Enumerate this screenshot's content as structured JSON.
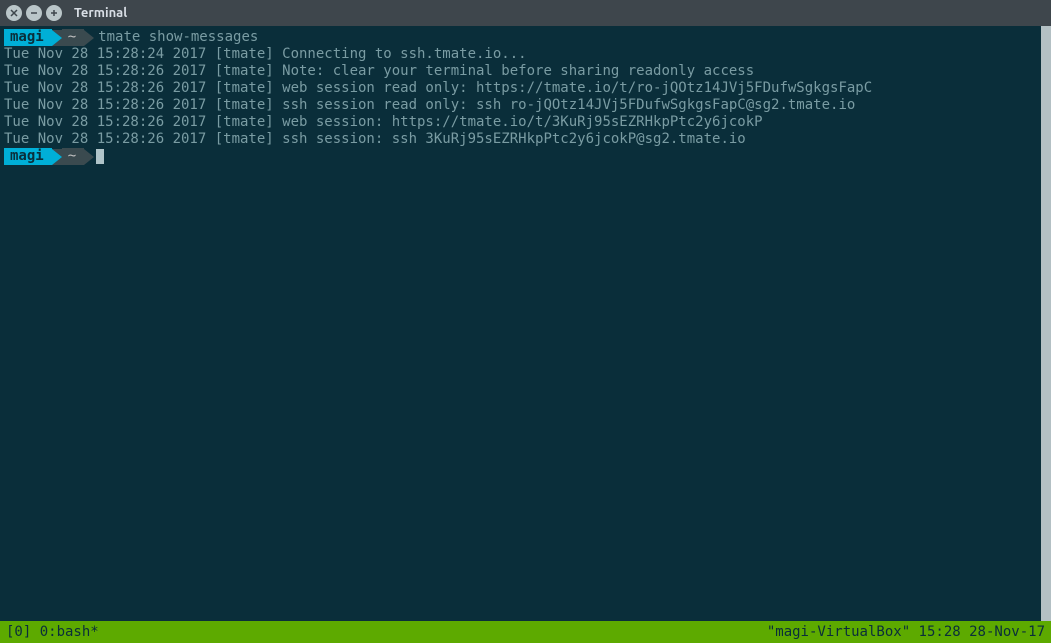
{
  "window": {
    "title": "Terminal"
  },
  "prompt1": {
    "user": "magi",
    "path": "~",
    "command": "tmate show-messages"
  },
  "output": {
    "line1": "Tue Nov 28 15:28:24 2017 [tmate] Connecting to ssh.tmate.io...",
    "line2": "Tue Nov 28 15:28:26 2017 [tmate] Note: clear your terminal before sharing readonly access",
    "line3": "Tue Nov 28 15:28:26 2017 [tmate] web session read only: https://tmate.io/t/ro-jQOtz14JVj5FDufwSgkgsFapC",
    "line4": "Tue Nov 28 15:28:26 2017 [tmate] ssh session read only: ssh ro-jQOtz14JVj5FDufwSgkgsFapC@sg2.tmate.io",
    "line5": "Tue Nov 28 15:28:26 2017 [tmate] web session: https://tmate.io/t/3KuRj95sEZRHkpPtc2y6jcokP",
    "line6": "Tue Nov 28 15:28:26 2017 [tmate] ssh session: ssh 3KuRj95sEZRHkpPtc2y6jcokP@sg2.tmate.io"
  },
  "prompt2": {
    "user": "magi",
    "path": "~"
  },
  "statusbar": {
    "left": "[0] 0:bash*",
    "right": "\"magi-VirtualBox\" 15:28 28-Nov-17"
  }
}
